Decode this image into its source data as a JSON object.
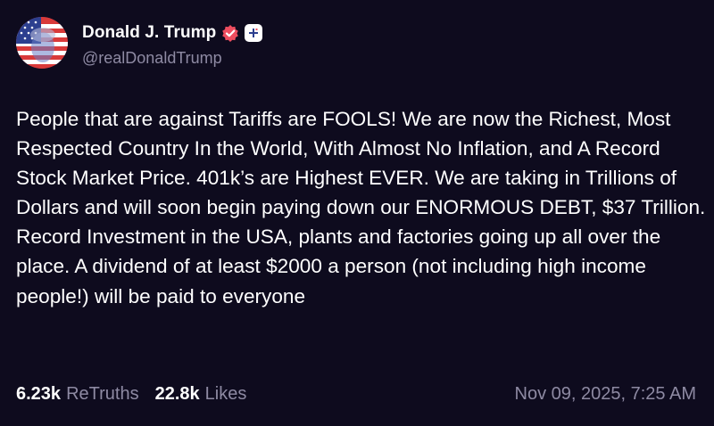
{
  "author": {
    "display_name": "Donald J. Trump",
    "handle": "@realDonaldTrump",
    "verified_icon": "verified-badge-icon",
    "follow_icon": "plus-icon",
    "badge_color": "#ee4d5f"
  },
  "post": {
    "text": "People that are against Tariffs are FOOLS! We are now the Richest, Most Respected Country In the World, With Almost No Inflation, and A Record Stock Market Price. 401k’s are Highest EVER. We are taking in Trillions of Dollars and will soon begin paying down our ENORMOUS DEBT, $37 Trillion. Record Investment in the USA, plants and factories going up all over the place. A dividend of at least $2000 a person (not including high income people!) will be paid to everyone"
  },
  "stats": {
    "retruths_count": "6.23k",
    "retruths_label": "ReTruths",
    "likes_count": "22.8k",
    "likes_label": "Likes"
  },
  "timestamp": "Nov 09, 2025, 7:25 AM",
  "colors": {
    "background": "#0e0b1e",
    "text": "#ffffff",
    "muted": "#8e8aa3"
  }
}
